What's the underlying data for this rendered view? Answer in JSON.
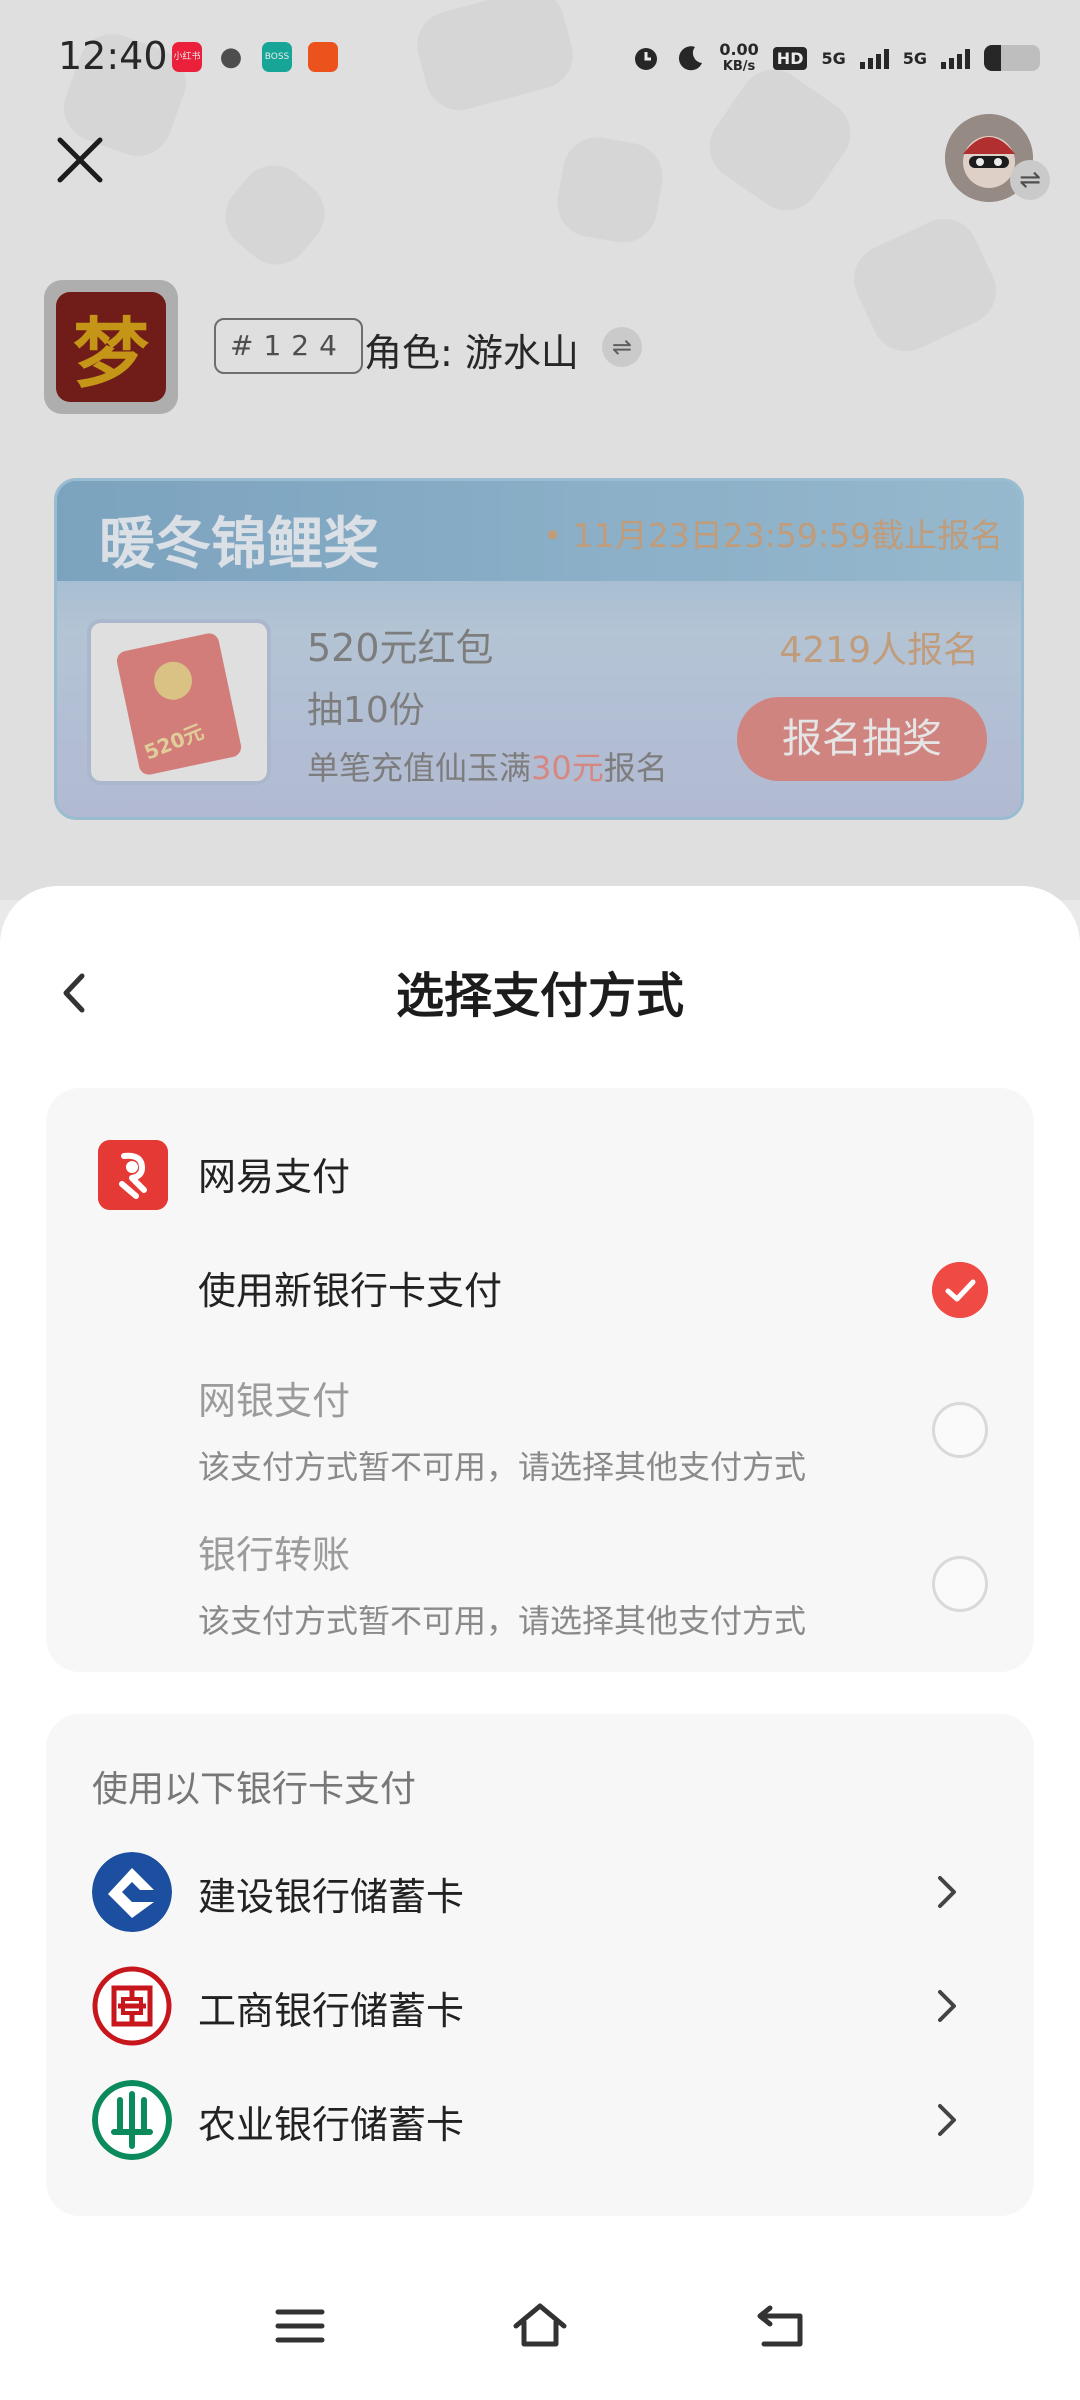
{
  "status_bar": {
    "time": "12:40",
    "app_icons": [
      {
        "name": "xiaohongshu-icon",
        "label": "小红书",
        "color": "#ff2442"
      },
      {
        "name": "wechat-icon",
        "label": "",
        "color": "#555555"
      },
      {
        "name": "boss-zhipin-icon",
        "label": "BOSS",
        "color": "#19b4a5"
      },
      {
        "name": "taobao-icon",
        "label": "",
        "color": "#ff5a1f"
      }
    ],
    "net_speed_value": "0.00",
    "net_speed_unit": "KB/s",
    "hd_label": "HD",
    "sim1_label": "5G",
    "sim2_label": "5G",
    "battery_level": 0.3
  },
  "header": {
    "close_glyph": "✕",
    "swap_glyph": "⇌"
  },
  "game": {
    "icon_glyph": "梦",
    "server_tag": "#124",
    "role_label": "角色: 游水山"
  },
  "banner": {
    "title": "暖冬锦鲤奖",
    "deadline": "• 11月23日23:59:59截止报名",
    "prize_amount_on_packet": "520元",
    "prize_name": "520元红包",
    "prize_count": "抽10份",
    "rule_prefix": "单笔充值仙玉满",
    "rule_highlight": "30元",
    "rule_suffix": "报名",
    "signup_count": "4219人报名",
    "signup_button": "报名抽奖"
  },
  "sheet": {
    "title": "选择支付方式",
    "provider": {
      "name": "网易支付",
      "icon": "netease-pay-icon",
      "color": "#e53935"
    },
    "options": [
      {
        "title": "使用新银行卡支付",
        "subtitle": "",
        "enabled": true,
        "checked": true
      },
      {
        "title": "网银支付",
        "subtitle": "该支付方式暂不可用，请选择其他支付方式",
        "enabled": false,
        "checked": false
      },
      {
        "title": "银行转账",
        "subtitle": "该支付方式暂不可用，请选择其他支付方式",
        "enabled": false,
        "checked": false
      }
    ],
    "bank_section_title": "使用以下银行卡支付",
    "banks": [
      {
        "name": "建设银行储蓄卡",
        "icon": "ccb-logo-icon",
        "color": "#1c4fa0"
      },
      {
        "name": "工商银行储蓄卡",
        "icon": "icbc-logo-icon",
        "color": "#c8161d"
      },
      {
        "name": "农业银行储蓄卡",
        "icon": "abc-logo-icon",
        "color": "#0b8a5c"
      }
    ],
    "accent_color": "#f04a45"
  },
  "nav_bar": {
    "buttons": [
      "menu-icon",
      "home-icon",
      "back-nav-icon"
    ]
  }
}
